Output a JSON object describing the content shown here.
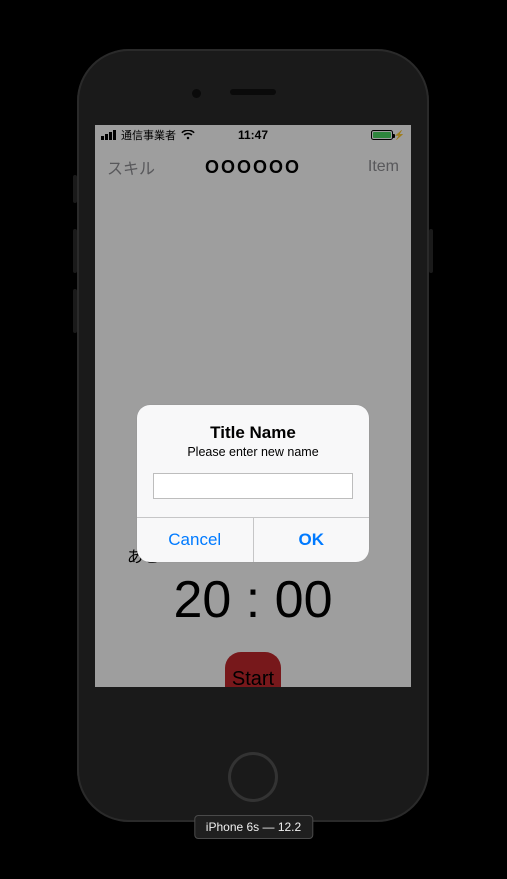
{
  "status": {
    "carrier": "通信事業者",
    "time": "11:47"
  },
  "navbar": {
    "left": "スキル",
    "title": "OOOOOO",
    "right": "Item"
  },
  "content": {
    "countdown_label": "あと",
    "timer": "20 : 00",
    "start_label": "Start"
  },
  "alert": {
    "title": "Title Name",
    "message": "Please enter new name",
    "input_value": "",
    "input_placeholder": "",
    "cancel": "Cancel",
    "ok": "OK"
  },
  "device": {
    "label": "iPhone 6s — 12.2"
  }
}
